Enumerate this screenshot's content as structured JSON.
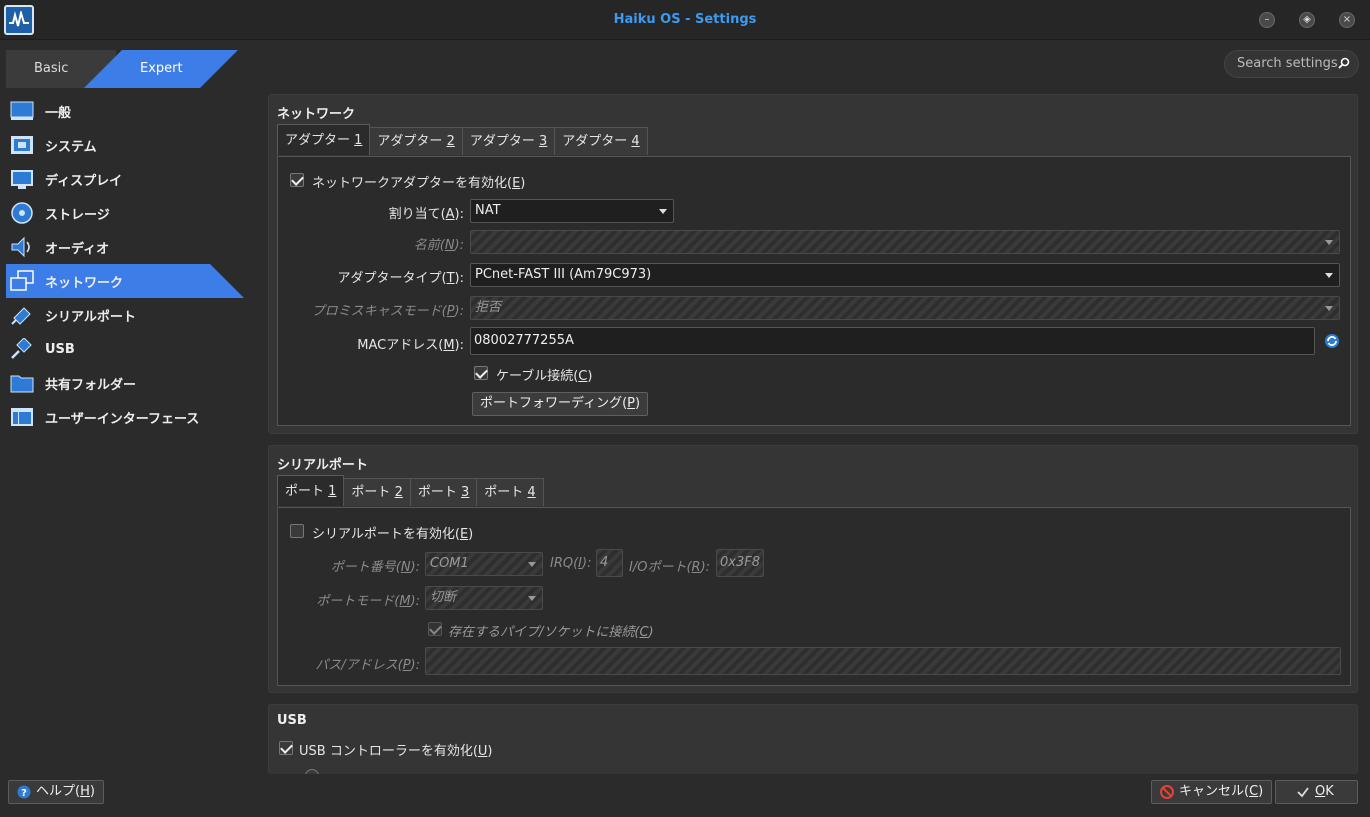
{
  "window": {
    "title": "Haiku OS - Settings"
  },
  "modes": {
    "basic": "Basic",
    "expert": "Expert"
  },
  "search": {
    "placeholder": "Search settings"
  },
  "sidebar": {
    "items": [
      {
        "label": "一般",
        "icon": "general-icon"
      },
      {
        "label": "システム",
        "icon": "system-icon"
      },
      {
        "label": "ディスプレイ",
        "icon": "display-icon"
      },
      {
        "label": "ストレージ",
        "icon": "storage-icon"
      },
      {
        "label": "オーディオ",
        "icon": "audio-icon"
      },
      {
        "label": "ネットワーク",
        "icon": "network-icon",
        "active": true
      },
      {
        "label": "シリアルポート",
        "icon": "serial-port-icon"
      },
      {
        "label": "USB",
        "icon": "usb-icon"
      },
      {
        "label": "共有フォルダー",
        "icon": "shared-folder-icon"
      },
      {
        "label": "ユーザーインターフェース",
        "icon": "user-interface-icon"
      }
    ]
  },
  "network": {
    "title": "ネットワーク",
    "tabs": [
      {
        "pre": "アダプター ",
        "key": "1"
      },
      {
        "pre": "アダプター ",
        "key": "2"
      },
      {
        "pre": "アダプター ",
        "key": "3"
      },
      {
        "pre": "アダプター ",
        "key": "4"
      }
    ],
    "enable": {
      "pre": "ネットワークアダプターを有効化(",
      "key": "E",
      "post": ")",
      "checked": true
    },
    "attach": {
      "pre": "割り当て(",
      "key": "A",
      "post": "):",
      "value": "NAT"
    },
    "name": {
      "pre": "名前(",
      "key": "N",
      "post": "):",
      "value": ""
    },
    "adapter_type": {
      "pre": "アダプタータイプ(",
      "key": "T",
      "post": "):",
      "value": "PCnet-FAST III (Am79C973)"
    },
    "promisc": {
      "pre": "プロミスキャスモード(",
      "key": "P",
      "post": "):",
      "value": "拒否"
    },
    "mac": {
      "pre": "MACアドレス(",
      "key": "M",
      "post": "):",
      "value": "08002777255A"
    },
    "cable": {
      "pre": "ケーブル接続(",
      "key": "C",
      "post": ")",
      "checked": true
    },
    "port_forward": {
      "pre": "ポートフォワーディング(",
      "key": "P",
      "post": ")"
    }
  },
  "serial": {
    "title": "シリアルポート",
    "tabs": [
      {
        "pre": "ポート ",
        "key": "1"
      },
      {
        "pre": "ポート ",
        "key": "2"
      },
      {
        "pre": "ポート ",
        "key": "3"
      },
      {
        "pre": "ポート ",
        "key": "4"
      }
    ],
    "enable": {
      "pre": "シリアルポートを有効化(",
      "key": "E",
      "post": ")",
      "checked": false
    },
    "port_number": {
      "pre": "ポート番号(",
      "key": "N",
      "post": "):",
      "value": "COM1"
    },
    "irq": {
      "pre": "IRQ(",
      "key": "I",
      "post": "):",
      "value": "4"
    },
    "io_port": {
      "pre": "I/Oポート(",
      "key": "R",
      "post": "):",
      "value": "0x3F8"
    },
    "port_mode": {
      "pre": "ポートモード(",
      "key": "M",
      "post": "):",
      "value": "切断"
    },
    "existing": {
      "pre": "存在するパイプ/ソケットに接続(",
      "key": "C",
      "post": ")",
      "checked": true
    },
    "path": {
      "pre": "パス/アドレス(",
      "key": "P",
      "post": "):",
      "value": ""
    }
  },
  "usb": {
    "title": "USB",
    "enable": {
      "pre": "USB コントローラーを有効化(",
      "key": "U",
      "post": ")",
      "checked": true
    }
  },
  "footer": {
    "help": {
      "pre": "ヘルプ(",
      "key": "H",
      "post": ")"
    },
    "cancel": {
      "pre": "キャンセル(",
      "key": "C",
      "post": ")"
    },
    "ok": {
      "key": "O",
      "post": "K"
    }
  },
  "colors": {
    "accent": "#3d7de8",
    "title": "#3c9bf0",
    "background": "#2b2b2b",
    "panel": "#353535"
  }
}
